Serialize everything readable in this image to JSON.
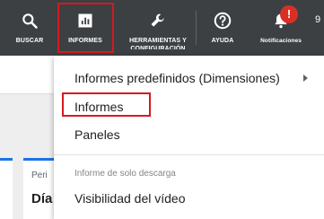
{
  "toolbar": {
    "items": [
      {
        "label": "BUSCAR",
        "icon": "search-icon"
      },
      {
        "label": "INFORMES",
        "icon": "bar-chart-icon"
      },
      {
        "label": "HERRAMIENTAS Y CONFIGURACIÓN",
        "icon": "wrench-icon"
      },
      {
        "label": "AYUDA",
        "icon": "help-circle-icon"
      },
      {
        "label": "Notificaciones",
        "icon": "bell-icon"
      }
    ],
    "notification_badge": "!",
    "edge_text": "9",
    "background_color": "#3c4043",
    "highlight_color": "#d61920"
  },
  "menu": {
    "items": [
      {
        "label": "Informes predefinidos (Dimensiones)",
        "has_submenu": true
      },
      {
        "label": "Informes"
      },
      {
        "label": "Paneles"
      }
    ],
    "section_header": "Informe de solo descarga",
    "section_items": [
      {
        "label": "Visibilidad del vídeo"
      }
    ]
  },
  "background": {
    "card_label": "Peri",
    "card_value": "Día",
    "accent_color": "#1a73e8"
  }
}
